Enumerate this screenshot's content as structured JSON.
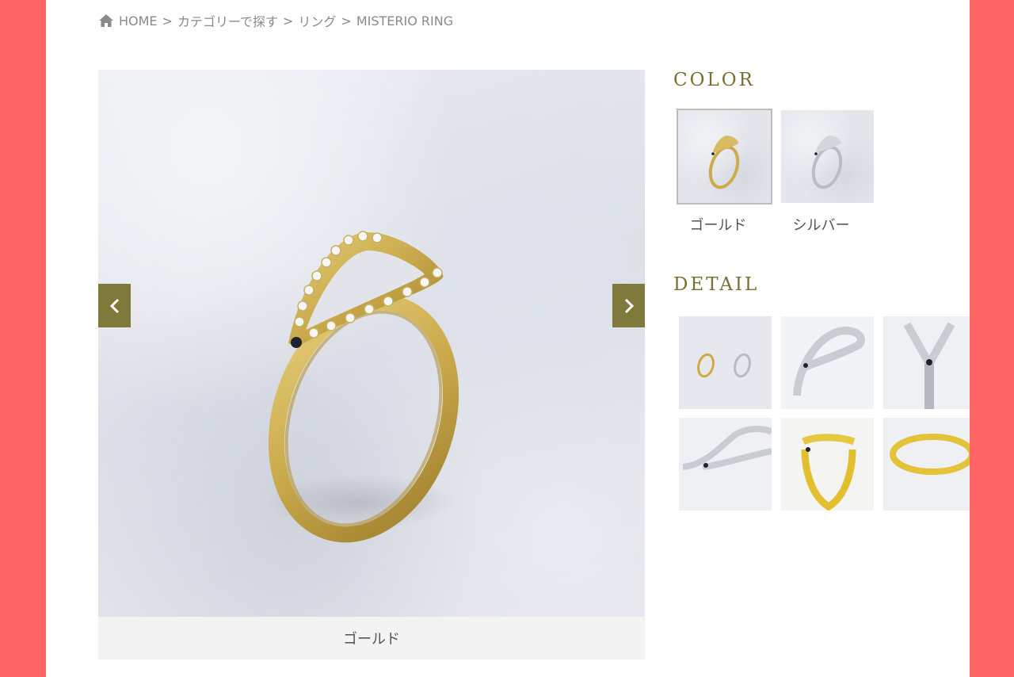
{
  "breadcrumb": {
    "home": "HOME",
    "separator": ">",
    "category": "カテゴリーで探す",
    "subcategory": "リング",
    "current": "MISTERIO RING"
  },
  "viewer": {
    "caption": "ゴールド",
    "prev_icon": "chevron-left-icon",
    "next_icon": "chevron-right-icon"
  },
  "color_section": {
    "title": "COLOR",
    "options": [
      {
        "label": "ゴールド",
        "selected": true
      },
      {
        "label": "シルバー",
        "selected": false
      }
    ]
  },
  "detail_section": {
    "title": "DETAIL",
    "thumbnails": 6
  },
  "colors": {
    "accent": "#7f7a3c",
    "title": "#7a6f33",
    "background_side": "#ff6464"
  }
}
